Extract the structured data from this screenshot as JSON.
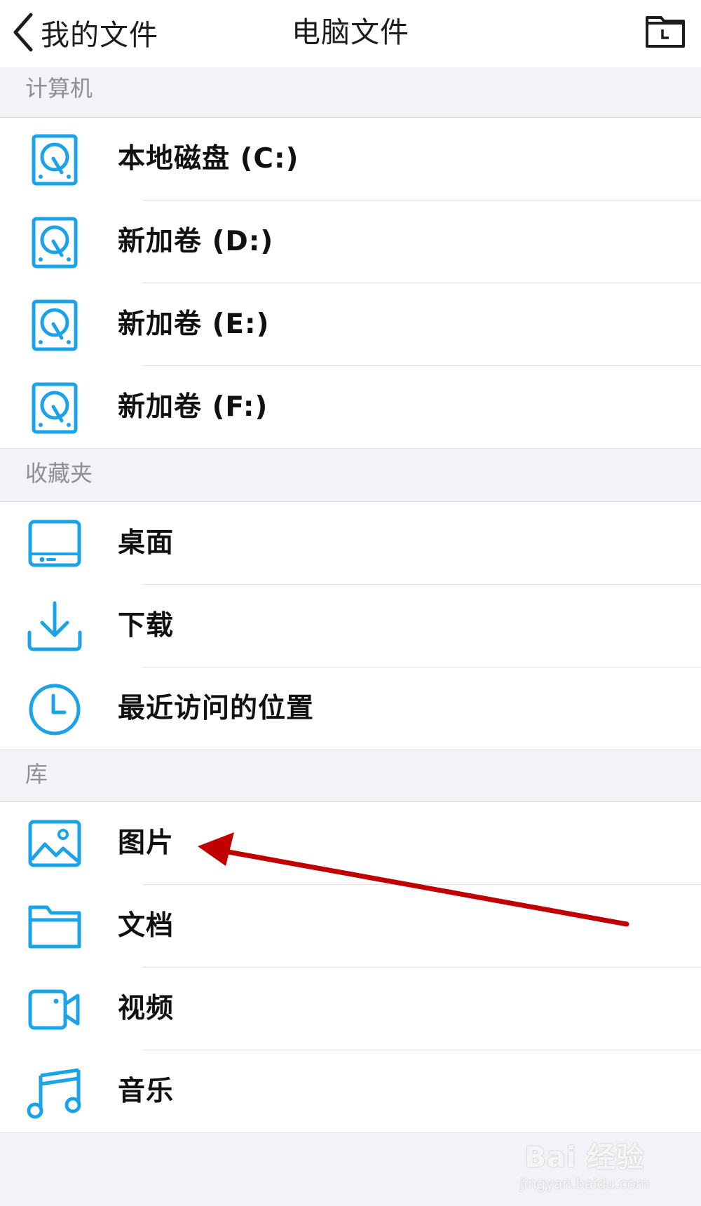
{
  "nav": {
    "back_label": "我的文件",
    "title": "电脑文件",
    "right_icon": "folder-history-icon"
  },
  "sections": [
    {
      "header": "计算机",
      "items": [
        {
          "label": "本地磁盘 (C:)",
          "icon": "hard-disk-icon"
        },
        {
          "label": "新加卷 (D:)",
          "icon": "hard-disk-icon"
        },
        {
          "label": "新加卷 (E:)",
          "icon": "hard-disk-icon"
        },
        {
          "label": "新加卷 (F:)",
          "icon": "hard-disk-icon"
        }
      ]
    },
    {
      "header": "收藏夹",
      "items": [
        {
          "label": "桌面",
          "icon": "desktop-icon"
        },
        {
          "label": "下载",
          "icon": "download-icon"
        },
        {
          "label": "最近访问的位置",
          "icon": "clock-icon"
        }
      ]
    },
    {
      "header": "库",
      "items": [
        {
          "label": "图片",
          "icon": "picture-icon"
        },
        {
          "label": "文档",
          "icon": "folder-icon"
        },
        {
          "label": "视频",
          "icon": "video-camera-icon"
        },
        {
          "label": "音乐",
          "icon": "music-note-icon"
        }
      ]
    }
  ],
  "watermark": {
    "main": "Bai 经验",
    "sub": "jingyan.baidu.com"
  },
  "colors": {
    "accent": "#1aa3e8",
    "annotation_arrow": "#c00000"
  }
}
